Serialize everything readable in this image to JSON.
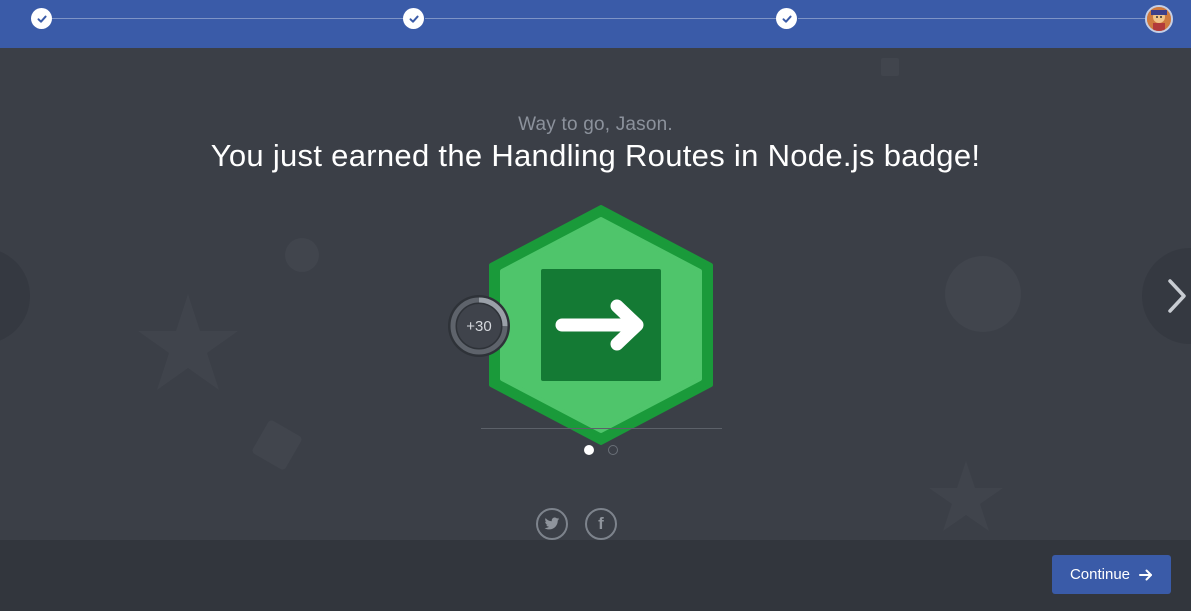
{
  "progress": {
    "steps": [
      {
        "state": "complete",
        "icon": "check-icon"
      },
      {
        "state": "complete",
        "icon": "check-icon"
      },
      {
        "state": "complete",
        "icon": "check-icon"
      },
      {
        "state": "current",
        "icon": "avatar"
      }
    ]
  },
  "celebration": {
    "subtitle": "Way to go, Jason.",
    "headline": "You just earned the Handling Routes in Node.js badge!"
  },
  "badge": {
    "icon": "arrow-right-icon",
    "points_label": "+30",
    "points_fill_fraction": 0.25,
    "colors": {
      "hex_outer": "#1a9a3a",
      "hex_inner": "#4fc56b",
      "square": "#147a34",
      "arrow": "#ffffff"
    }
  },
  "carousel": {
    "pages": 2,
    "active_index": 0
  },
  "share": {
    "twitter_icon": "twitter-icon",
    "facebook_glyph": "f"
  },
  "footer": {
    "continue_label": "Continue"
  },
  "colors": {
    "accent": "#3a5ba8",
    "stage_bg": "#3b3f47",
    "footer_bg": "#32363d"
  }
}
